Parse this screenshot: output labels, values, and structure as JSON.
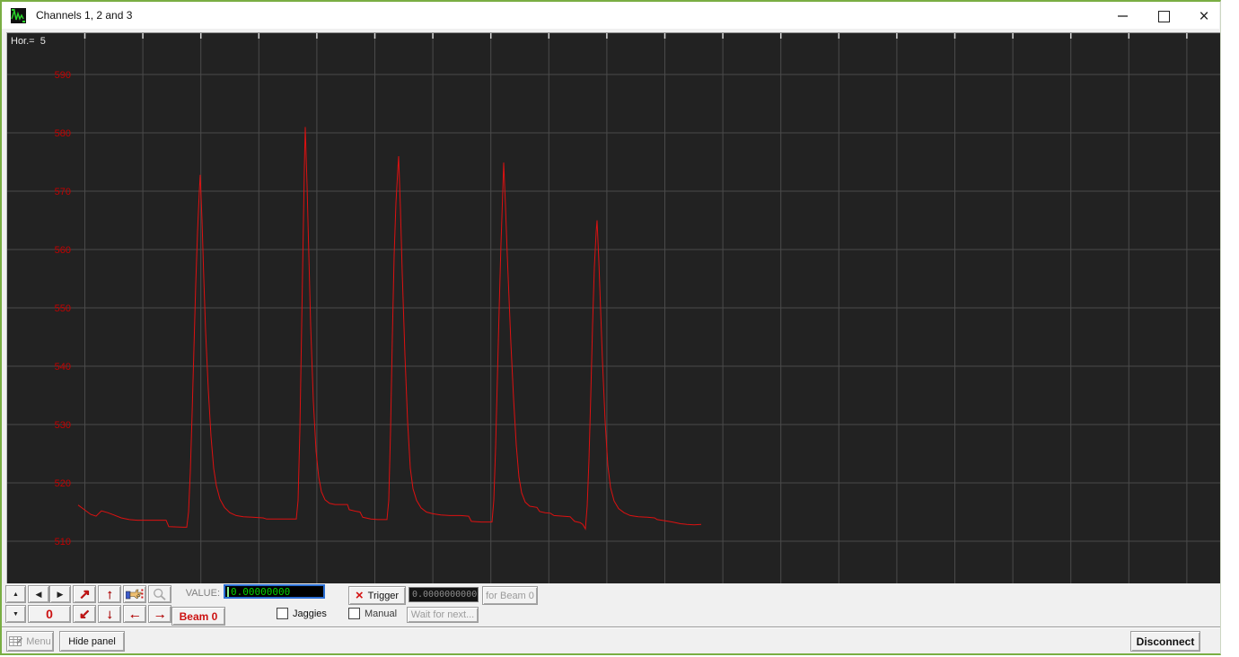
{
  "window": {
    "title": "Channels 1, 2 and 3",
    "close_glyph": "×"
  },
  "plot": {
    "hor_label": "Hor.=  5"
  },
  "chart_data": {
    "type": "line",
    "title": "Oscilloscope trace - Channels 1, 2 and 3",
    "xlabel": "",
    "ylabel": "",
    "x_unit": "screen px (no x-axis labels shown)",
    "y_tick_labels": [
      "590",
      "580",
      "570",
      "560",
      "550",
      "540",
      "530",
      "520",
      "510"
    ],
    "y_ticks": [
      590,
      580,
      570,
      560,
      550,
      540,
      530,
      520,
      510
    ],
    "ylim": [
      508.7,
      597.1
    ],
    "grid": true,
    "legend": "none",
    "horizontal_scale_readout": "Hor.= 5",
    "series": [
      {
        "name": "Beam 0",
        "color": "#dd1111",
        "points": [
          [
            86,
            516.2
          ],
          [
            93,
            515.4
          ],
          [
            100,
            514.6
          ],
          [
            106,
            514.3
          ],
          [
            112,
            515.2
          ],
          [
            119,
            514.9
          ],
          [
            126,
            514.5
          ],
          [
            134,
            514.0
          ],
          [
            143,
            513.7
          ],
          [
            152,
            513.6
          ],
          [
            168,
            513.6
          ],
          [
            184,
            513.6
          ],
          [
            187,
            512.5
          ],
          [
            203,
            512.4
          ],
          [
            207,
            512.4
          ],
          [
            209,
            515
          ],
          [
            211,
            522
          ],
          [
            213,
            532
          ],
          [
            215,
            543
          ],
          [
            217,
            554
          ],
          [
            219,
            563
          ],
          [
            221,
            570
          ],
          [
            222,
            572.8
          ],
          [
            224,
            565
          ],
          [
            226,
            555
          ],
          [
            228,
            546
          ],
          [
            231,
            536
          ],
          [
            234,
            528
          ],
          [
            237,
            522.5
          ],
          [
            240,
            519.5
          ],
          [
            244,
            517.2
          ],
          [
            249,
            515.8
          ],
          [
            255,
            514.9
          ],
          [
            262,
            514.4
          ],
          [
            270,
            514.2
          ],
          [
            280,
            514.1
          ],
          [
            292,
            514.0
          ],
          [
            296,
            513.8
          ],
          [
            312,
            513.8
          ],
          [
            329,
            513.8
          ],
          [
            331,
            517
          ],
          [
            333,
            529
          ],
          [
            335,
            547
          ],
          [
            337,
            565
          ],
          [
            338,
            574
          ],
          [
            339,
            581
          ],
          [
            341,
            571
          ],
          [
            343,
            559
          ],
          [
            345,
            547
          ],
          [
            348,
            534
          ],
          [
            351,
            525.5
          ],
          [
            354,
            521
          ],
          [
            357,
            518.5
          ],
          [
            361,
            517.1
          ],
          [
            366,
            516.5
          ],
          [
            372,
            516.3
          ],
          [
            380,
            516.3
          ],
          [
            386,
            516.3
          ],
          [
            388,
            515.4
          ],
          [
            396,
            515.1
          ],
          [
            400,
            515.0
          ],
          [
            403,
            514.1
          ],
          [
            412,
            513.8
          ],
          [
            420,
            513.7
          ],
          [
            430,
            513.7
          ],
          [
            432,
            517
          ],
          [
            434,
            529
          ],
          [
            436,
            545
          ],
          [
            438,
            559
          ],
          [
            440,
            568
          ],
          [
            442,
            573.5
          ],
          [
            443,
            576
          ],
          [
            445,
            567
          ],
          [
            447,
            556
          ],
          [
            450,
            542
          ],
          [
            453,
            530.5
          ],
          [
            456,
            522.5
          ],
          [
            459,
            519
          ],
          [
            463,
            517
          ],
          [
            468,
            515.7
          ],
          [
            474,
            515.0
          ],
          [
            481,
            514.7
          ],
          [
            490,
            514.5
          ],
          [
            500,
            514.4
          ],
          [
            512,
            514.4
          ],
          [
            521,
            514.3
          ],
          [
            524,
            513.4
          ],
          [
            535,
            513.3
          ],
          [
            547,
            513.3
          ],
          [
            549,
            517
          ],
          [
            551,
            526
          ],
          [
            553,
            538
          ],
          [
            555,
            550
          ],
          [
            557,
            561
          ],
          [
            559,
            570
          ],
          [
            560,
            574.9
          ],
          [
            562,
            567.5
          ],
          [
            564,
            559
          ],
          [
            566,
            551.5
          ],
          [
            568,
            544
          ],
          [
            571,
            534.5
          ],
          [
            574,
            526.5
          ],
          [
            577,
            521
          ],
          [
            580,
            518.3
          ],
          [
            584,
            516.7
          ],
          [
            589,
            516.0
          ],
          [
            597,
            515.8
          ],
          [
            600,
            515.1
          ],
          [
            606,
            514.9
          ],
          [
            612,
            514.8
          ],
          [
            616,
            514.4
          ],
          [
            626,
            514.3
          ],
          [
            634,
            514.2
          ],
          [
            639,
            513.4
          ],
          [
            645,
            513.2
          ],
          [
            648,
            512.9
          ],
          [
            651,
            512.1
          ],
          [
            653,
            516
          ],
          [
            655,
            524
          ],
          [
            657,
            535
          ],
          [
            659,
            547
          ],
          [
            661,
            557
          ],
          [
            663,
            563
          ],
          [
            664,
            565
          ],
          [
            666,
            558
          ],
          [
            668,
            549.5
          ],
          [
            670,
            541
          ],
          [
            673,
            530.5
          ],
          [
            676,
            523
          ],
          [
            679,
            519.2
          ],
          [
            683,
            516.9
          ],
          [
            688,
            515.6
          ],
          [
            694,
            514.9
          ],
          [
            701,
            514.4
          ],
          [
            710,
            514.2
          ],
          [
            720,
            514.1
          ],
          [
            728,
            514.0
          ],
          [
            731,
            513.7
          ],
          [
            740,
            513.5
          ],
          [
            748,
            513.3
          ],
          [
            757,
            513.0
          ],
          [
            764,
            512.9
          ],
          [
            772,
            512.8
          ],
          [
            780,
            512.9
          ]
        ]
      }
    ]
  },
  "panel": {
    "nav": {
      "up": "▲",
      "down": "▼",
      "left": "◀",
      "right": "▶",
      "zero": "0"
    },
    "arrows": {
      "ne": "↗",
      "up": "↑",
      "sw": "↙",
      "down": "↓",
      "left": "←",
      "right": "→"
    },
    "beam_label": "Beam 0",
    "value_label": "VALUE:",
    "value": "0.00000000",
    "jaggies_label": "Jaggies",
    "trigger": {
      "x_glyph": "×",
      "label": "Trigger",
      "value": "0.0000000000",
      "for_beam_label": "for Beam 0",
      "manual_label": "Manual",
      "wait_label": "Wait for next..."
    }
  },
  "bottom_bar": {
    "menu_label": "Menu",
    "hide_panel_label": "Hide panel",
    "disconnect_label": "Disconnect"
  },
  "colors": {
    "window_border": "#7aae43",
    "plot_bg": "#222222",
    "grid": "#4a4a4a",
    "top_tick": "#d8d8d8",
    "axis_label": "#c40000",
    "trace": "#dd1111",
    "value_text": "#00d400",
    "panel_bg": "#f0f0f0"
  }
}
